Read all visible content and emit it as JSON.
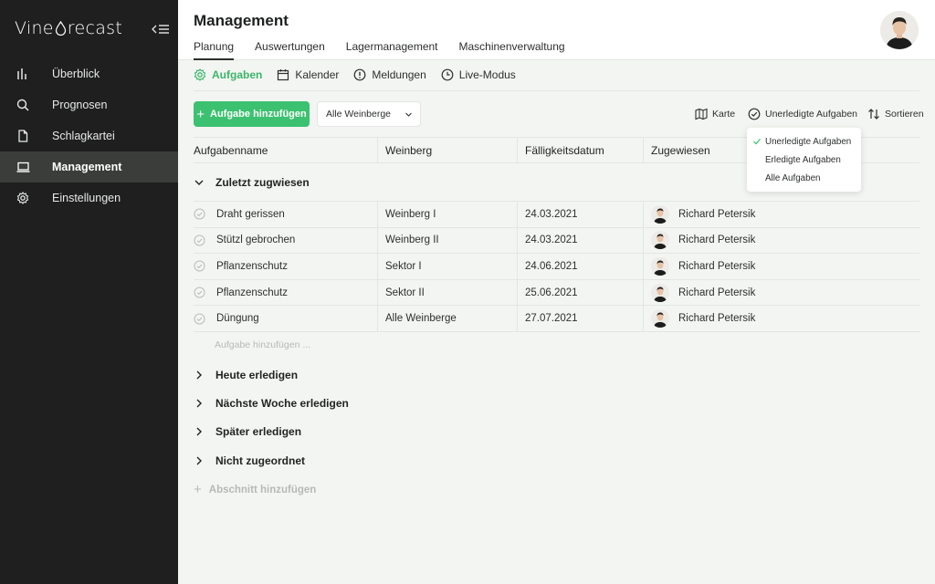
{
  "brand": {
    "name_pre": "Vine",
    "name_post": "recast"
  },
  "sidebar": {
    "items": [
      {
        "label": "Überblick",
        "icon": "bar-chart-icon"
      },
      {
        "label": "Prognosen",
        "icon": "search-icon"
      },
      {
        "label": "Schlagkartei",
        "icon": "document-icon"
      },
      {
        "label": "Management",
        "icon": "laptop-icon",
        "active": true
      },
      {
        "label": "Einstellungen",
        "icon": "gear-icon"
      }
    ]
  },
  "header": {
    "title": "Management",
    "tabs": [
      "Planung",
      "Auswertungen",
      "Lagermanagement",
      "Maschinenverwaltung"
    ],
    "active_tab": "Planung"
  },
  "subtabs": {
    "items": [
      {
        "label": "Aufgaben",
        "icon": "gear-icon",
        "active": true
      },
      {
        "label": "Kalender",
        "icon": "calendar-icon"
      },
      {
        "label": "Meldungen",
        "icon": "alert-icon"
      },
      {
        "label": "Live-Modus",
        "icon": "clock-icon"
      }
    ]
  },
  "toolbar": {
    "add_task_label": "Aufgabe hinzufügen",
    "vineyard_select": "Alle Weinberge",
    "map_label": "Karte",
    "filter_label": "Unerledigte Aufgaben",
    "sort_label": "Sortieren"
  },
  "filter_menu": {
    "options": [
      "Unerledigte Aufgaben",
      "Erledigte Aufgaben",
      "Alle Aufgaben"
    ],
    "selected": "Unerledigte Aufgaben"
  },
  "table": {
    "columns": [
      "Aufgabenname",
      "Weinberg",
      "Fälligkeitsdatum",
      "Zugewiesen"
    ],
    "group_title": "Zuletzt zugwiesen",
    "rows": [
      {
        "name": "Draht gerissen",
        "vineyard": "Weinberg I",
        "due": "24.03.2021",
        "assignee": "Richard Petersik"
      },
      {
        "name": "Stützl gebrochen",
        "vineyard": "Weinberg II",
        "due": "24.03.2021",
        "assignee": "Richard Petersik"
      },
      {
        "name": "Pflanzenschutz",
        "vineyard": "Sektor I",
        "due": "24.06.2021",
        "assignee": "Richard Petersik"
      },
      {
        "name": "Pflanzenschutz",
        "vineyard": "Sektor II",
        "due": "25.06.2021",
        "assignee": "Richard Petersik"
      },
      {
        "name": "Düngung",
        "vineyard": "Alle Weinberge",
        "due": "27.07.2021",
        "assignee": "Richard Petersik"
      }
    ],
    "add_row_placeholder": "Aufgabe hinzufügen ..."
  },
  "sections": [
    "Heute erledigen",
    "Nächste Woche erledigen",
    "Später erledigen",
    "Nicht zugeordnet"
  ],
  "add_section_label": "Abschnitt hinzufügen",
  "colors": {
    "accent": "#3cc170",
    "sidebar_bg": "#1e1f1e",
    "sidebar_active": "#3a3d3a"
  }
}
